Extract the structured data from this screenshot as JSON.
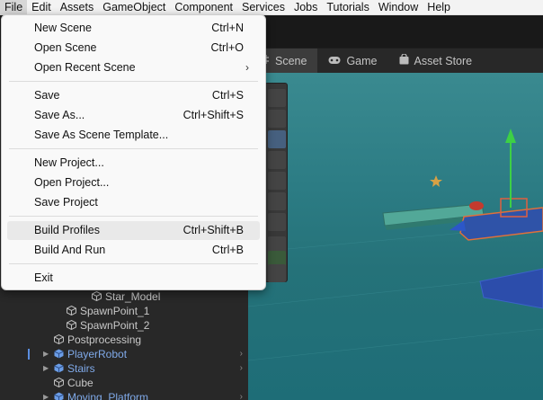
{
  "menubar": {
    "items": [
      "File",
      "Edit",
      "Assets",
      "GameObject",
      "Component",
      "Services",
      "Jobs",
      "Tutorials",
      "Window",
      "Help"
    ]
  },
  "file_menu": {
    "new_scene": {
      "label": "New Scene",
      "shortcut": "Ctrl+N"
    },
    "open_scene": {
      "label": "Open Scene",
      "shortcut": "Ctrl+O"
    },
    "open_recent_scene": {
      "label": "Open Recent Scene"
    },
    "save": {
      "label": "Save",
      "shortcut": "Ctrl+S"
    },
    "save_as": {
      "label": "Save As...",
      "shortcut": "Ctrl+Shift+S"
    },
    "save_as_template": {
      "label": "Save As Scene Template..."
    },
    "new_project": {
      "label": "New Project..."
    },
    "open_project": {
      "label": "Open Project..."
    },
    "save_project": {
      "label": "Save Project"
    },
    "build_profiles": {
      "label": "Build Profiles",
      "shortcut": "Ctrl+Shift+B"
    },
    "build_and_run": {
      "label": "Build And Run",
      "shortcut": "Ctrl+B"
    },
    "exit": {
      "label": "Exit"
    }
  },
  "tabs": {
    "scene": "Scene",
    "game": "Game",
    "asset_store": "Asset Store"
  },
  "hierarchy": {
    "items": [
      {
        "label": "Star_Model"
      },
      {
        "label": "SpawnPoint_1"
      },
      {
        "label": "SpawnPoint_2"
      },
      {
        "label": "Postprocessing"
      },
      {
        "label": "PlayerRobot"
      },
      {
        "label": "Stairs"
      },
      {
        "label": "Cube"
      },
      {
        "label": "Moving_Platform"
      }
    ]
  },
  "colors": {
    "prefab_blue": "#7fa9e8",
    "scene_teal": "#2c7c84",
    "menu_bg": "#f9f9f9"
  }
}
